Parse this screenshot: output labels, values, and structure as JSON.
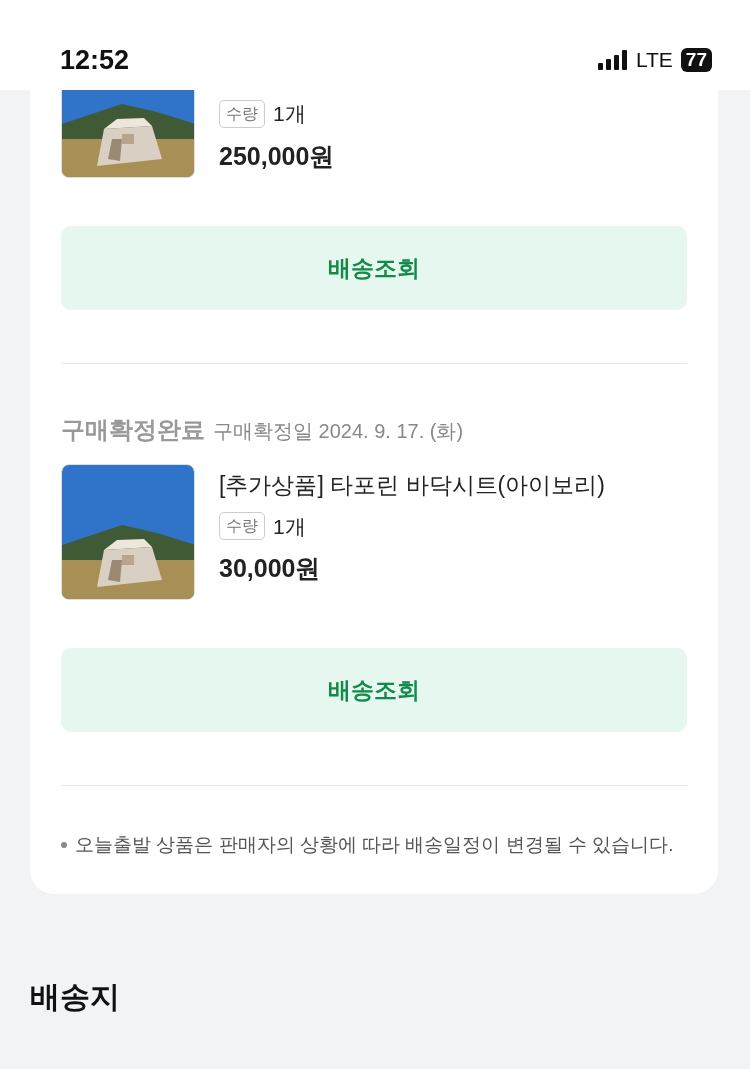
{
  "status_bar": {
    "time": "12:52",
    "network": "LTE",
    "battery": "77"
  },
  "orders": [
    {
      "cut_top": true,
      "qty_label": "수량",
      "qty": "1개",
      "price": "250,000원",
      "button": "배송조회"
    },
    {
      "cut_top": false,
      "status": "구매확정완료",
      "date": "구매확정일 2024. 9. 17. (화)",
      "title": "[추가상품] 타포린 바닥시트(아이보리)",
      "qty_label": "수량",
      "qty": "1개",
      "price": "30,000원",
      "button": "배송조회"
    }
  ],
  "notice": "오늘출발 상품은 판매자의 상황에 따라 배송일정이 변경될 수 있습니다.",
  "section_title": "배송지"
}
